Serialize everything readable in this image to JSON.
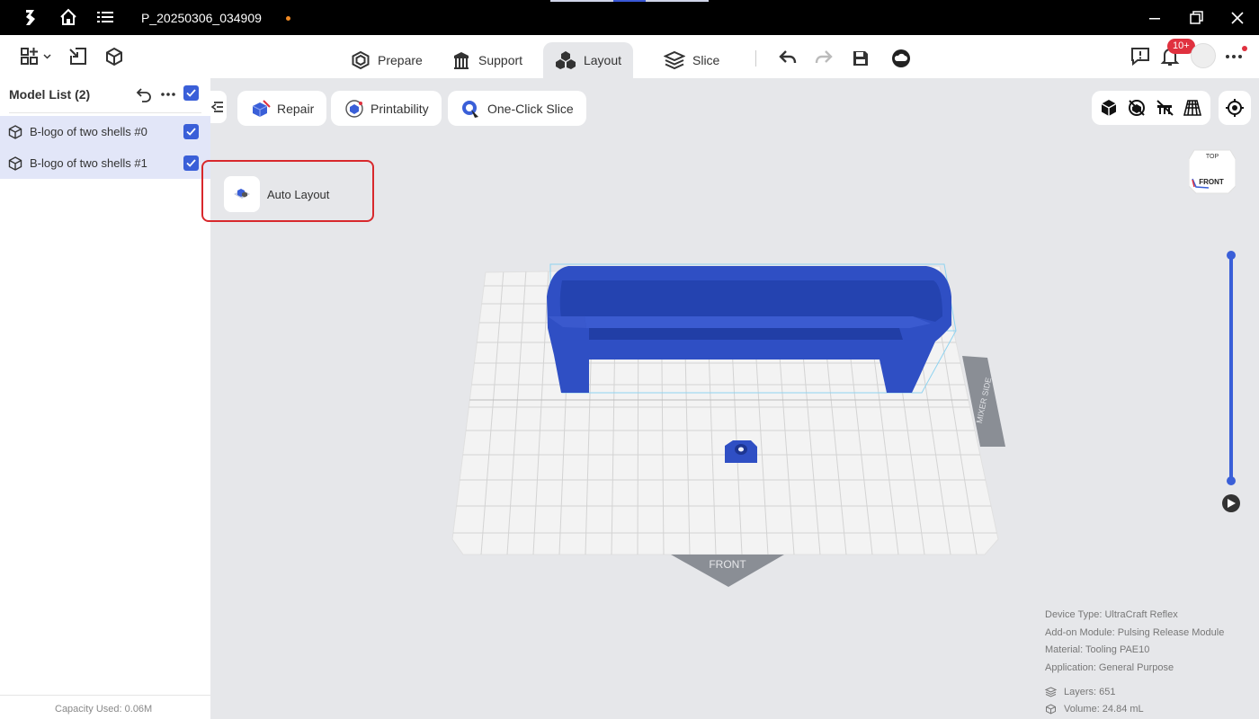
{
  "titlebar": {
    "filename": "P_20250306_034909",
    "icons": [
      "app-logo-icon",
      "home-icon",
      "menu-list-icon",
      "minimize-icon",
      "restore-icon",
      "close-icon"
    ],
    "unsaved_dot_color": "#f08a24"
  },
  "toolbar": {
    "tabs": [
      {
        "label": "Prepare",
        "icon": "prepare-icon"
      },
      {
        "label": "Support",
        "icon": "support-icon"
      },
      {
        "label": "Layout",
        "icon": "layout-icon",
        "active": true
      },
      {
        "label": "Slice",
        "icon": "slice-icon"
      }
    ],
    "notifications_badge": "10+",
    "icons": [
      "add-model-icon",
      "import-icon",
      "model-icon",
      "undo-icon",
      "redo-icon",
      "save-icon",
      "cloud-icon",
      "feedback-icon",
      "bell-icon",
      "more-icon"
    ]
  },
  "sidebar": {
    "title": "Model List (2)",
    "models": [
      {
        "name": "B-logo of two shells #0",
        "checked": true
      },
      {
        "name": "B-logo of two shells #1",
        "checked": true
      }
    ],
    "capacity": "Capacity Used: 0.06M"
  },
  "workspace": {
    "buttons": [
      {
        "label": "Repair",
        "icon": "repair-icon"
      },
      {
        "label": "Printability",
        "icon": "printability-icon"
      },
      {
        "label": "One-Click Slice",
        "icon": "one-click-slice-icon"
      }
    ],
    "auto_layout_label": "Auto Layout",
    "viewcube": {
      "top": "TOP",
      "front": "FRONT"
    },
    "bed_labels": {
      "front": "FRONT",
      "side": "MIXER SIDE"
    },
    "view_tools": [
      "solid-view-icon",
      "xray-view-icon",
      "hide-support-icon",
      "grid-view-icon",
      "locate-icon"
    ],
    "layer_slider": {
      "upper_level": 1.0,
      "lower_level": 0.0
    },
    "model_color": "#2f4fc4",
    "accent_color": "#3a5fd8"
  },
  "info": {
    "device_type": "Device Type:  UltraCraft Reflex",
    "addon_module": "Add-on Module:  Pulsing Release Module",
    "material": "Material:  Tooling PAE10",
    "application": "Application:  General Purpose",
    "layers": "Layers: 651",
    "volume": "Volume: 24.84 mL"
  }
}
